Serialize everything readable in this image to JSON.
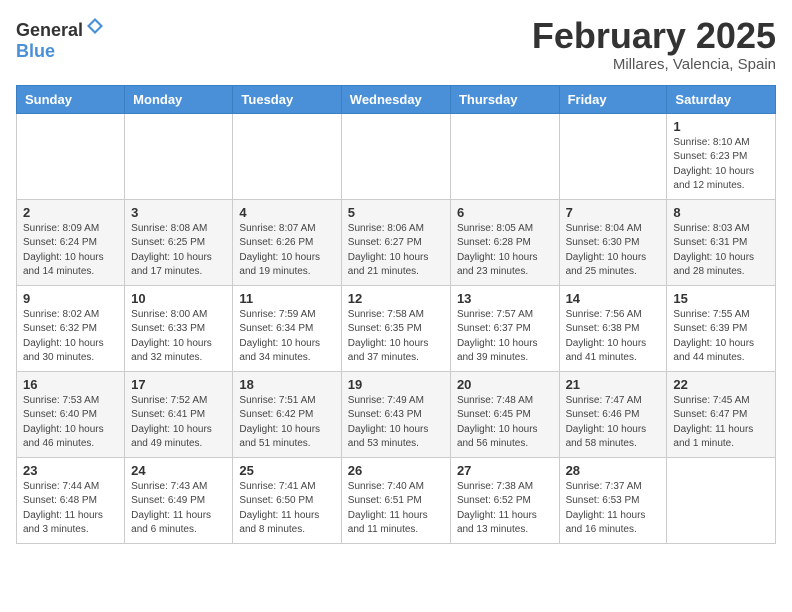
{
  "header": {
    "logo_general": "General",
    "logo_blue": "Blue",
    "title": "February 2025",
    "subtitle": "Millares, Valencia, Spain"
  },
  "days_of_week": [
    "Sunday",
    "Monday",
    "Tuesday",
    "Wednesday",
    "Thursday",
    "Friday",
    "Saturday"
  ],
  "weeks": [
    {
      "days": [
        {
          "num": "",
          "info": ""
        },
        {
          "num": "",
          "info": ""
        },
        {
          "num": "",
          "info": ""
        },
        {
          "num": "",
          "info": ""
        },
        {
          "num": "",
          "info": ""
        },
        {
          "num": "",
          "info": ""
        },
        {
          "num": "1",
          "info": "Sunrise: 8:10 AM\nSunset: 6:23 PM\nDaylight: 10 hours\nand 12 minutes."
        }
      ]
    },
    {
      "days": [
        {
          "num": "2",
          "info": "Sunrise: 8:09 AM\nSunset: 6:24 PM\nDaylight: 10 hours\nand 14 minutes."
        },
        {
          "num": "3",
          "info": "Sunrise: 8:08 AM\nSunset: 6:25 PM\nDaylight: 10 hours\nand 17 minutes."
        },
        {
          "num": "4",
          "info": "Sunrise: 8:07 AM\nSunset: 6:26 PM\nDaylight: 10 hours\nand 19 minutes."
        },
        {
          "num": "5",
          "info": "Sunrise: 8:06 AM\nSunset: 6:27 PM\nDaylight: 10 hours\nand 21 minutes."
        },
        {
          "num": "6",
          "info": "Sunrise: 8:05 AM\nSunset: 6:28 PM\nDaylight: 10 hours\nand 23 minutes."
        },
        {
          "num": "7",
          "info": "Sunrise: 8:04 AM\nSunset: 6:30 PM\nDaylight: 10 hours\nand 25 minutes."
        },
        {
          "num": "8",
          "info": "Sunrise: 8:03 AM\nSunset: 6:31 PM\nDaylight: 10 hours\nand 28 minutes."
        }
      ]
    },
    {
      "days": [
        {
          "num": "9",
          "info": "Sunrise: 8:02 AM\nSunset: 6:32 PM\nDaylight: 10 hours\nand 30 minutes."
        },
        {
          "num": "10",
          "info": "Sunrise: 8:00 AM\nSunset: 6:33 PM\nDaylight: 10 hours\nand 32 minutes."
        },
        {
          "num": "11",
          "info": "Sunrise: 7:59 AM\nSunset: 6:34 PM\nDaylight: 10 hours\nand 34 minutes."
        },
        {
          "num": "12",
          "info": "Sunrise: 7:58 AM\nSunset: 6:35 PM\nDaylight: 10 hours\nand 37 minutes."
        },
        {
          "num": "13",
          "info": "Sunrise: 7:57 AM\nSunset: 6:37 PM\nDaylight: 10 hours\nand 39 minutes."
        },
        {
          "num": "14",
          "info": "Sunrise: 7:56 AM\nSunset: 6:38 PM\nDaylight: 10 hours\nand 41 minutes."
        },
        {
          "num": "15",
          "info": "Sunrise: 7:55 AM\nSunset: 6:39 PM\nDaylight: 10 hours\nand 44 minutes."
        }
      ]
    },
    {
      "days": [
        {
          "num": "16",
          "info": "Sunrise: 7:53 AM\nSunset: 6:40 PM\nDaylight: 10 hours\nand 46 minutes."
        },
        {
          "num": "17",
          "info": "Sunrise: 7:52 AM\nSunset: 6:41 PM\nDaylight: 10 hours\nand 49 minutes."
        },
        {
          "num": "18",
          "info": "Sunrise: 7:51 AM\nSunset: 6:42 PM\nDaylight: 10 hours\nand 51 minutes."
        },
        {
          "num": "19",
          "info": "Sunrise: 7:49 AM\nSunset: 6:43 PM\nDaylight: 10 hours\nand 53 minutes."
        },
        {
          "num": "20",
          "info": "Sunrise: 7:48 AM\nSunset: 6:45 PM\nDaylight: 10 hours\nand 56 minutes."
        },
        {
          "num": "21",
          "info": "Sunrise: 7:47 AM\nSunset: 6:46 PM\nDaylight: 10 hours\nand 58 minutes."
        },
        {
          "num": "22",
          "info": "Sunrise: 7:45 AM\nSunset: 6:47 PM\nDaylight: 11 hours\nand 1 minute."
        }
      ]
    },
    {
      "days": [
        {
          "num": "23",
          "info": "Sunrise: 7:44 AM\nSunset: 6:48 PM\nDaylight: 11 hours\nand 3 minutes."
        },
        {
          "num": "24",
          "info": "Sunrise: 7:43 AM\nSunset: 6:49 PM\nDaylight: 11 hours\nand 6 minutes."
        },
        {
          "num": "25",
          "info": "Sunrise: 7:41 AM\nSunset: 6:50 PM\nDaylight: 11 hours\nand 8 minutes."
        },
        {
          "num": "26",
          "info": "Sunrise: 7:40 AM\nSunset: 6:51 PM\nDaylight: 11 hours\nand 11 minutes."
        },
        {
          "num": "27",
          "info": "Sunrise: 7:38 AM\nSunset: 6:52 PM\nDaylight: 11 hours\nand 13 minutes."
        },
        {
          "num": "28",
          "info": "Sunrise: 7:37 AM\nSunset: 6:53 PM\nDaylight: 11 hours\nand 16 minutes."
        },
        {
          "num": "",
          "info": ""
        }
      ]
    }
  ]
}
